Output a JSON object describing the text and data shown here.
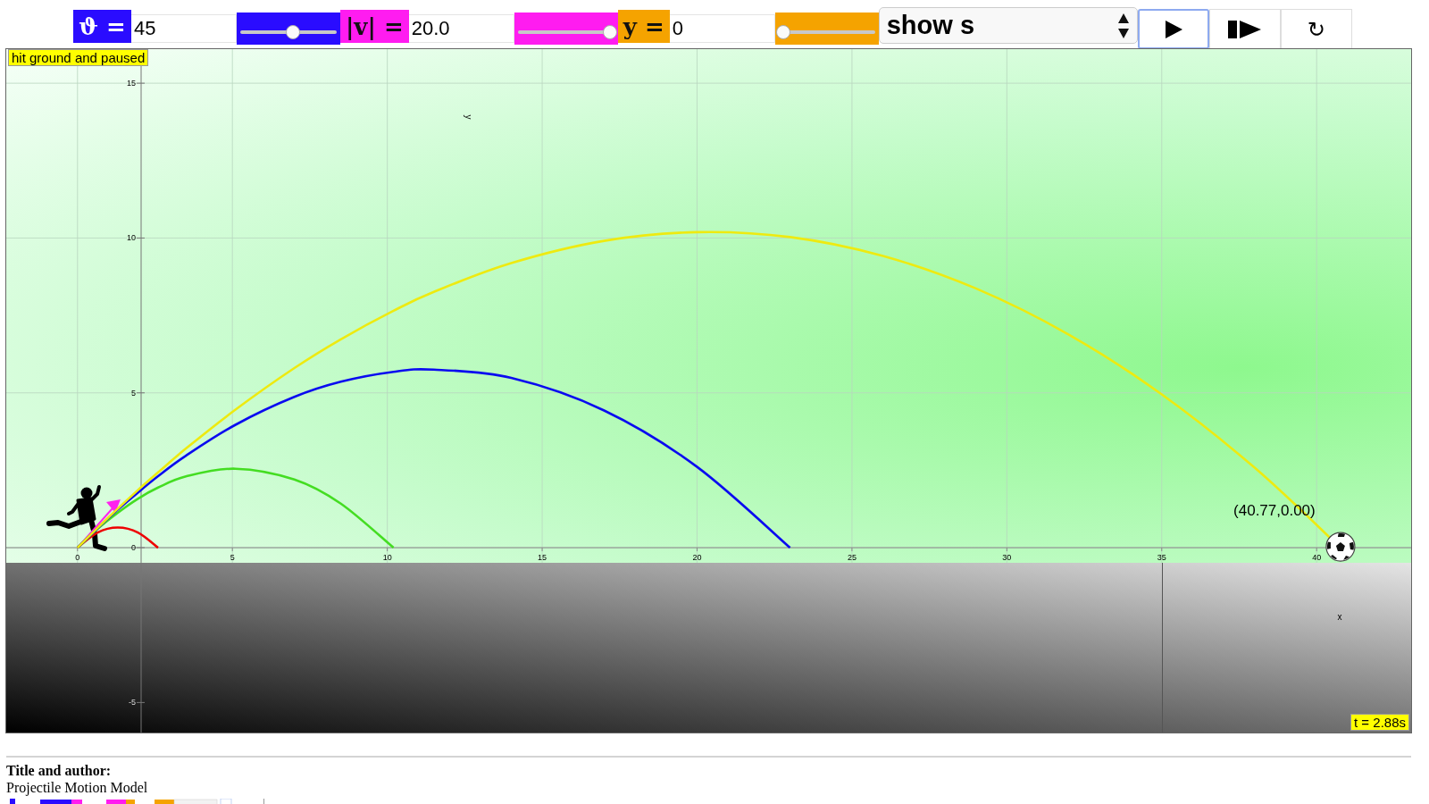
{
  "parameters": [
    {
      "symbol": "ϑ =",
      "value": "45",
      "color": "#2a0cff",
      "level": 0.55
    },
    {
      "symbol": "|v| =",
      "value": "20.0",
      "color": "#ff1cf0",
      "level": 1.0
    },
    {
      "symbol": "y =",
      "value": "0",
      "color": "#f5a300",
      "level": 0.0
    }
  ],
  "view_select": {
    "value": "show s"
  },
  "buttons": [
    {
      "kind": "play",
      "focused": true
    },
    {
      "kind": "step",
      "focused": false
    },
    {
      "kind": "reset",
      "label": "↻",
      "focused": false
    }
  ],
  "status": "hit ground and paused",
  "time": "t = 2.88s",
  "chart_data": {
    "type": "line",
    "grid": true,
    "xlabel": "x",
    "ylabel": "y",
    "xlim": [
      -2.3,
      43.05
    ],
    "ylim": [
      -5.97,
      16.1
    ],
    "xticks": [
      0,
      5,
      10,
      15,
      20,
      25,
      30,
      35,
      40
    ],
    "yticks": [
      -5,
      0,
      5,
      10,
      15
    ],
    "x": [
      0,
      0.65,
      1.3,
      1.95,
      2.6,
      3.5,
      5.1,
      7,
      8.5,
      10.2,
      11.5,
      14,
      17,
      20,
      23,
      26,
      29,
      32,
      35,
      38,
      40.77
    ],
    "series": [
      {
        "color": "#ee0000",
        "values": [
          0,
          0.49,
          0.65,
          0.49,
          0,
          null,
          null,
          null,
          null,
          null,
          null,
          null,
          null,
          null,
          null,
          null,
          null,
          null,
          null,
          null,
          null
        ]
      },
      {
        "color": "#44dd22",
        "values": [
          0,
          0.61,
          1.13,
          1.58,
          1.94,
          2.3,
          2.55,
          2.2,
          1.42,
          0,
          null,
          null,
          null,
          null,
          null,
          null,
          null,
          null,
          null,
          null,
          null
        ]
      },
      {
        "color": "#0a0af0",
        "values": [
          0,
          0.63,
          1.23,
          1.78,
          2.31,
          2.97,
          3.97,
          4.87,
          5.36,
          5.68,
          5.75,
          5.48,
          4.43,
          2.61,
          0,
          null,
          null,
          null,
          null,
          null,
          null
        ]
      },
      {
        "color": "#eeea10",
        "values": [
          0,
          0.64,
          1.26,
          1.86,
          2.43,
          3.2,
          4.46,
          5.8,
          6.73,
          7.65,
          8.26,
          9.19,
          9.91,
          10.19,
          10.03,
          9.42,
          8.37,
          6.88,
          4.95,
          2.58,
          0
        ]
      }
    ],
    "annotations": [
      {
        "x": 40.77,
        "y": 0,
        "text": "(40.77,0.00)"
      }
    ]
  },
  "info": {
    "heading": "Title and author:",
    "title": "Projectile Motion Model"
  }
}
